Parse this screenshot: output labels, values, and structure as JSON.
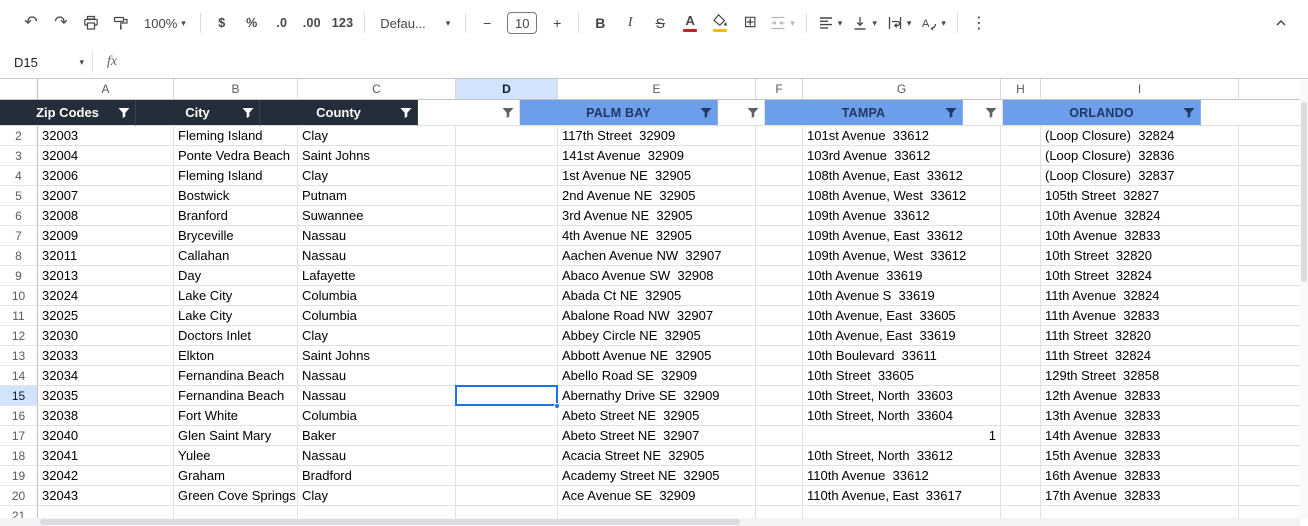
{
  "toolbar": {
    "icons": {
      "undo": "↶",
      "redo": "↷",
      "caret": "▾",
      "borders": "⊞",
      "more": "⋮"
    },
    "zoom_value": "100%",
    "currency_label": "$",
    "percent_label": "%",
    "decrease_decimal_label": ".0",
    "increase_decimal_label": ".00",
    "number_format_label": "123",
    "font_name_value": "Defau...",
    "decrease_font_label": "−",
    "font_size_value": "10",
    "increase_font_label": "+",
    "bold_label": "B",
    "italic_label": "I",
    "strikethrough_label": "S",
    "text_color_label": "A",
    "rotate_letter": "A"
  },
  "formula_bar": {
    "name_box_value": "D15",
    "fx_label": "fx"
  },
  "grid": {
    "column_letters": [
      "A",
      "B",
      "C",
      "D",
      "E",
      "F",
      "G",
      "H",
      "I"
    ],
    "selected": {
      "column": "D",
      "row": 15
    },
    "right_aligned": [
      {
        "column": "G",
        "row": 17
      }
    ],
    "filter_row": [
      {
        "col": "A",
        "text": "Zip Codes",
        "style": "dark"
      },
      {
        "col": "B",
        "text": "City",
        "style": "dark"
      },
      {
        "col": "C",
        "text": "County",
        "style": "dark"
      },
      {
        "col": "D",
        "text": "",
        "style": "plain"
      },
      {
        "col": "E",
        "text": "PALM BAY",
        "style": "blue"
      },
      {
        "col": "F",
        "text": "",
        "style": "plain"
      },
      {
        "col": "G",
        "text": "TAMPA",
        "style": "blue"
      },
      {
        "col": "H",
        "text": "",
        "style": "plain"
      },
      {
        "col": "I",
        "text": "ORLANDO",
        "style": "blue"
      }
    ],
    "rows": [
      {
        "n": 2,
        "cells": [
          "32003",
          "Fleming Island",
          "Clay",
          "",
          "117th Street  32909",
          "",
          "101st Avenue  33612",
          "",
          "(Loop Closure)  32824"
        ]
      },
      {
        "n": 3,
        "cells": [
          "32004",
          "Ponte Vedra Beach",
          "Saint Johns",
          "",
          "141st Avenue  32909",
          "",
          "103rd Avenue  33612",
          "",
          "(Loop Closure)  32836"
        ]
      },
      {
        "n": 4,
        "cells": [
          "32006",
          "Fleming Island",
          "Clay",
          "",
          "1st Avenue NE  32905",
          "",
          "108th Avenue, East  33612",
          "",
          "(Loop Closure)  32837"
        ]
      },
      {
        "n": 5,
        "cells": [
          "32007",
          "Bostwick",
          "Putnam",
          "",
          "2nd Avenue NE  32905",
          "",
          "108th Avenue, West  33612",
          "",
          "105th Street  32827"
        ]
      },
      {
        "n": 6,
        "cells": [
          "32008",
          "Branford",
          "Suwannee",
          "",
          "3rd Avenue NE  32905",
          "",
          "109th Avenue  33612",
          "",
          "10th Avenue  32824"
        ]
      },
      {
        "n": 7,
        "cells": [
          "32009",
          "Bryceville",
          "Nassau",
          "",
          "4th Avenue NE  32905",
          "",
          "109th Avenue, East  33612",
          "",
          "10th Avenue  32833"
        ]
      },
      {
        "n": 8,
        "cells": [
          "32011",
          "Callahan",
          "Nassau",
          "",
          "Aachen Avenue NW  32907",
          "",
          "109th Avenue, West  33612",
          "",
          "10th Street  32820"
        ]
      },
      {
        "n": 9,
        "cells": [
          "32013",
          "Day",
          "Lafayette",
          "",
          "Abaco Avenue SW  32908",
          "",
          "10th Avenue  33619",
          "",
          "10th Street  32824"
        ]
      },
      {
        "n": 10,
        "cells": [
          "32024",
          "Lake City",
          "Columbia",
          "",
          "Abada Ct NE  32905",
          "",
          "10th Avenue S  33619",
          "",
          "11th Avenue  32824"
        ]
      },
      {
        "n": 11,
        "cells": [
          "32025",
          "Lake City",
          "Columbia",
          "",
          "Abalone Road NW  32907",
          "",
          "10th Avenue, East  33605",
          "",
          "11th Avenue  32833"
        ]
      },
      {
        "n": 12,
        "cells": [
          "32030",
          "Doctors Inlet",
          "Clay",
          "",
          "Abbey Circle NE  32905",
          "",
          "10th Avenue, East  33619",
          "",
          "11th Street  32820"
        ]
      },
      {
        "n": 13,
        "cells": [
          "32033",
          "Elkton",
          "Saint Johns",
          "",
          "Abbott Avenue NE  32905",
          "",
          "10th Boulevard  33611",
          "",
          "11th Street  32824"
        ]
      },
      {
        "n": 14,
        "cells": [
          "32034",
          "Fernandina Beach",
          "Nassau",
          "",
          "Abello Road SE  32909",
          "",
          "10th Street  33605",
          "",
          "129th Street  32858"
        ]
      },
      {
        "n": 15,
        "cells": [
          "32035",
          "Fernandina Beach",
          "Nassau",
          "",
          "Abernathy Drive SE  32909",
          "",
          "10th Street, North  33603",
          "",
          "12th Avenue  32833"
        ]
      },
      {
        "n": 16,
        "cells": [
          "32038",
          "Fort White",
          "Columbia",
          "",
          "Abeto Street NE  32905",
          "",
          "10th Street, North  33604",
          "",
          "13th Avenue  32833"
        ]
      },
      {
        "n": 17,
        "cells": [
          "32040",
          "Glen Saint Mary",
          "Baker",
          "",
          "Abeto Street NE  32907",
          "",
          "1",
          "",
          "14th Avenue  32833"
        ]
      },
      {
        "n": 18,
        "cells": [
          "32041",
          "Yulee",
          "Nassau",
          "",
          "Acacia Street NE  32905",
          "",
          "10th Street, North  33612",
          "",
          "15th Avenue  32833"
        ]
      },
      {
        "n": 19,
        "cells": [
          "32042",
          "Graham",
          "Bradford",
          "",
          "Academy Street NE  32905",
          "",
          "110th Avenue  33612",
          "",
          "16th Avenue  32833"
        ]
      },
      {
        "n": 20,
        "cells": [
          "32043",
          "Green Cove Springs",
          "Clay",
          "",
          "Ace Avenue SE  32909",
          "",
          "110th Avenue, East  33617",
          "",
          "17th Avenue  32833"
        ]
      }
    ],
    "partial_row_number": "21"
  },
  "colors": {
    "accent_blue": "#1a73e8",
    "selected_header_bg": "#d3e3fd",
    "dark_header_bg": "#242d3a",
    "blue_header_bg": "#6d9eeb",
    "blue_header_text": "#1f3864",
    "text_color_indicator": "#c5221f",
    "fill_color_indicator": "#fbbc04"
  }
}
